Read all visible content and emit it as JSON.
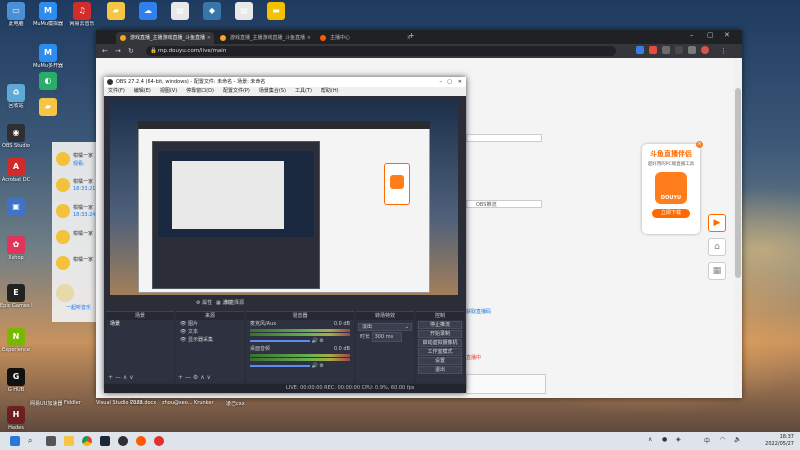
{
  "desktop": {
    "icons_left": [
      {
        "label": "此电脑",
        "color": "#4a90d9",
        "glyph": "▭"
      },
      {
        "label": "回收站",
        "color": "#5fa9d6",
        "glyph": "♻"
      },
      {
        "label": "OBS Studio",
        "color": "#302e31",
        "glyph": "◉"
      },
      {
        "label": "Acrobat DC",
        "color": "#d12a2a",
        "glyph": "A"
      },
      {
        "label": "",
        "color": "#3f73c7",
        "glyph": "▣"
      },
      {
        "label": "Xshop",
        "color": "#e0345a",
        "glyph": "✿"
      },
      {
        "label": "Epic Games Launcher",
        "color": "#222222",
        "glyph": "E"
      },
      {
        "label": "Experience",
        "color": "#76b900",
        "glyph": "N"
      },
      {
        "label": "G HUB",
        "color": "#111111",
        "glyph": "G"
      },
      {
        "label": "Hades",
        "color": "#6b1f1f",
        "glyph": "H"
      }
    ],
    "icons_top": [
      {
        "label": "MuMu模拟器",
        "color": "#2d8cf0",
        "glyph": "M"
      },
      {
        "label": "网易云音乐",
        "color": "#d42b2b",
        "glyph": "♫"
      },
      {
        "label": "",
        "color": "#f5c543",
        "glyph": "▰"
      },
      {
        "label": "",
        "color": "#2f80ed",
        "glyph": "☁"
      },
      {
        "label": "",
        "color": "#e8e8e8",
        "glyph": "▤"
      },
      {
        "label": "",
        "color": "#3776ab",
        "glyph": "◆"
      },
      {
        "label": "",
        "color": "#e8e8e8",
        "glyph": "▤"
      },
      {
        "label": "",
        "color": "#f5c000",
        "glyph": "▬"
      }
    ],
    "icons_col2": [
      {
        "label": "MuMu多开器",
        "color": "#2d8cf0",
        "glyph": "M"
      },
      {
        "label": "",
        "color": "#2aae67",
        "glyph": "◐"
      },
      {
        "label": "",
        "color": "#f5c543",
        "glyph": "▰"
      }
    ],
    "bottom_labels": [
      "网易UU加速器",
      "Fiddler",
      "Visual Studio Code",
      "2023.docx",
      "zhou@seo...",
      "Krunker",
      "凌己cxx"
    ]
  },
  "chrome": {
    "tabs": [
      {
        "title": "游戏直播_主播游戏直播_斗鱼直播",
        "active": true
      },
      {
        "title": "游戏直播_主播游戏直播_斗鱼直播",
        "active": false
      },
      {
        "title": "主播中心",
        "active": false
      }
    ],
    "url": "mp.douyu.com/live/main",
    "page_link_text": "获取直播码",
    "page_right_text": "OBS推流",
    "page_bottom_text": "直播中"
  },
  "ad": {
    "title": "斗鱼直播伴侣",
    "subtitle": "超好用的PC端直播工具",
    "brand": "DOUYU",
    "download": "立即下载"
  },
  "qq": {
    "items": [
      {
        "name": "柑橘一家",
        "time": "观看:"
      },
      {
        "name": "柑橘一家",
        "time": "18:33:21"
      },
      {
        "name": "柑橘一家",
        "time": "18:33:24"
      },
      {
        "name": "柑橘一家",
        "time": ""
      },
      {
        "name": "柑橘一家",
        "time": ""
      }
    ],
    "bottom": "一起听音乐"
  },
  "obs": {
    "title": "OBS 27.2.4 (64-bit, windows) - 配置文件: 未命名 - 场景: 未命名",
    "menu": [
      "文件(F)",
      "编辑(E)",
      "视图(V)",
      "停靠窗口(D)",
      "配置文件(P)",
      "场景集合(S)",
      "工具(T)",
      "帮助(H)"
    ],
    "no_source_text": "未选择源",
    "properties_btn": "属性",
    "filters_btn": "滤镜",
    "scenes_header": "场景",
    "scenes": [
      "场景"
    ],
    "sources_header": "来源",
    "sources": [
      "图片",
      "文本",
      "显示器采集"
    ],
    "mixer_header": "混音器",
    "mixer": [
      {
        "name": "麦克风/Aux",
        "db": "0.0 dB"
      },
      {
        "name": "桌面音频",
        "db": "0.0 dB"
      }
    ],
    "transitions_header": "转场特效",
    "transition": "淡出",
    "duration_label": "时长",
    "duration": "300 ms",
    "controls_header": "控制",
    "controls": [
      "停止推流",
      "开始录制",
      "启动虚拟摄像机",
      "工作室模式",
      "设置",
      "退出"
    ],
    "status": "LIVE: 00:00:00   REC: 00:00:00   CPU: 0.9%, 60.00 fps"
  },
  "taskbar": {
    "time": "18:37",
    "date": "2022/05/27",
    "lang": "中"
  },
  "colors": {
    "obs_bg": "#2b2e38",
    "douyu_orange": "#ff6a00",
    "chrome_dark": "#202124",
    "taskbar": "#dfe3ea"
  }
}
